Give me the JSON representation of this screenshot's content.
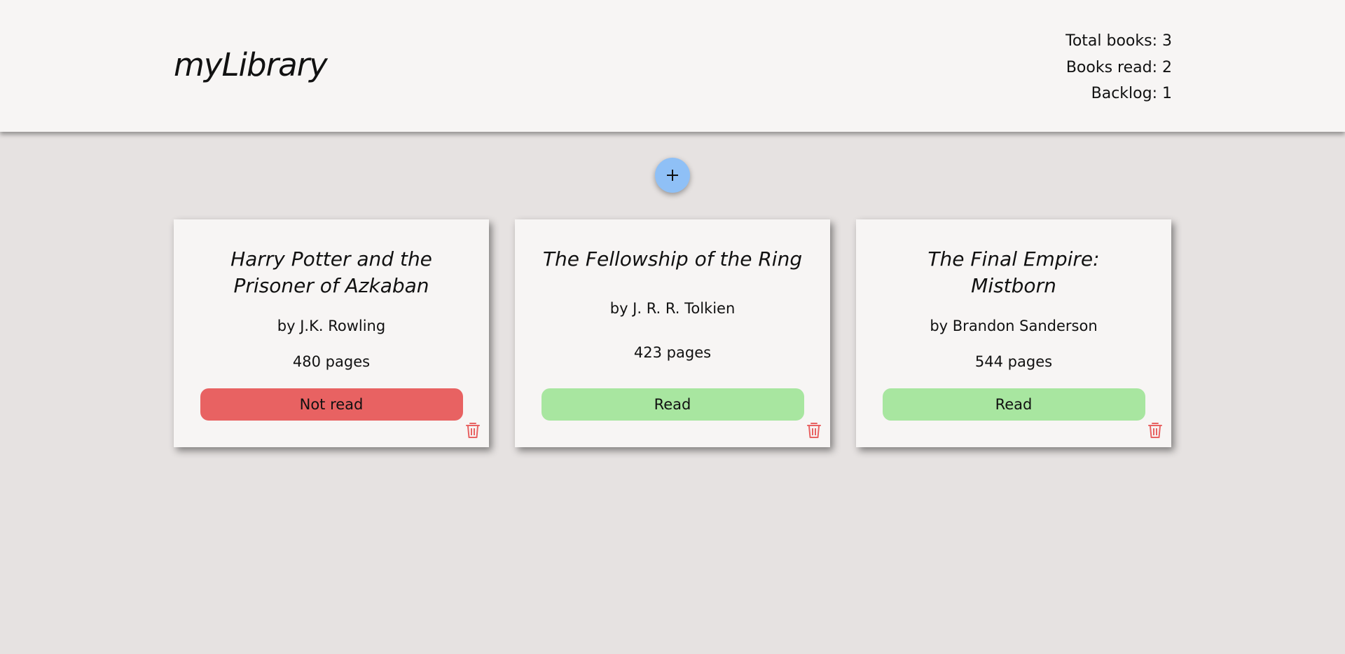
{
  "app": {
    "title": "myLibrary"
  },
  "stats": {
    "total": "Total books: 3",
    "read": "Books read: 2",
    "backlog": "Backlog: 1"
  },
  "add_button": {
    "icon": "plus-icon",
    "color": "#8fc0f6"
  },
  "colors": {
    "not_read": "#e86262",
    "read": "#a8e6a0",
    "trash": "#e86262"
  },
  "books": [
    {
      "title": "Harry Potter and the Prisoner of Azkaban",
      "author": "by J.K. Rowling",
      "pages": "480 pages",
      "status": "Not read"
    },
    {
      "title": "The Fellowship of the Ring",
      "author": "by J. R. R. Tolkien",
      "pages": "423 pages",
      "status": "Read"
    },
    {
      "title": "The Final Empire: Mistborn",
      "author": "by Brandon Sanderson",
      "pages": "544 pages",
      "status": "Read"
    }
  ]
}
